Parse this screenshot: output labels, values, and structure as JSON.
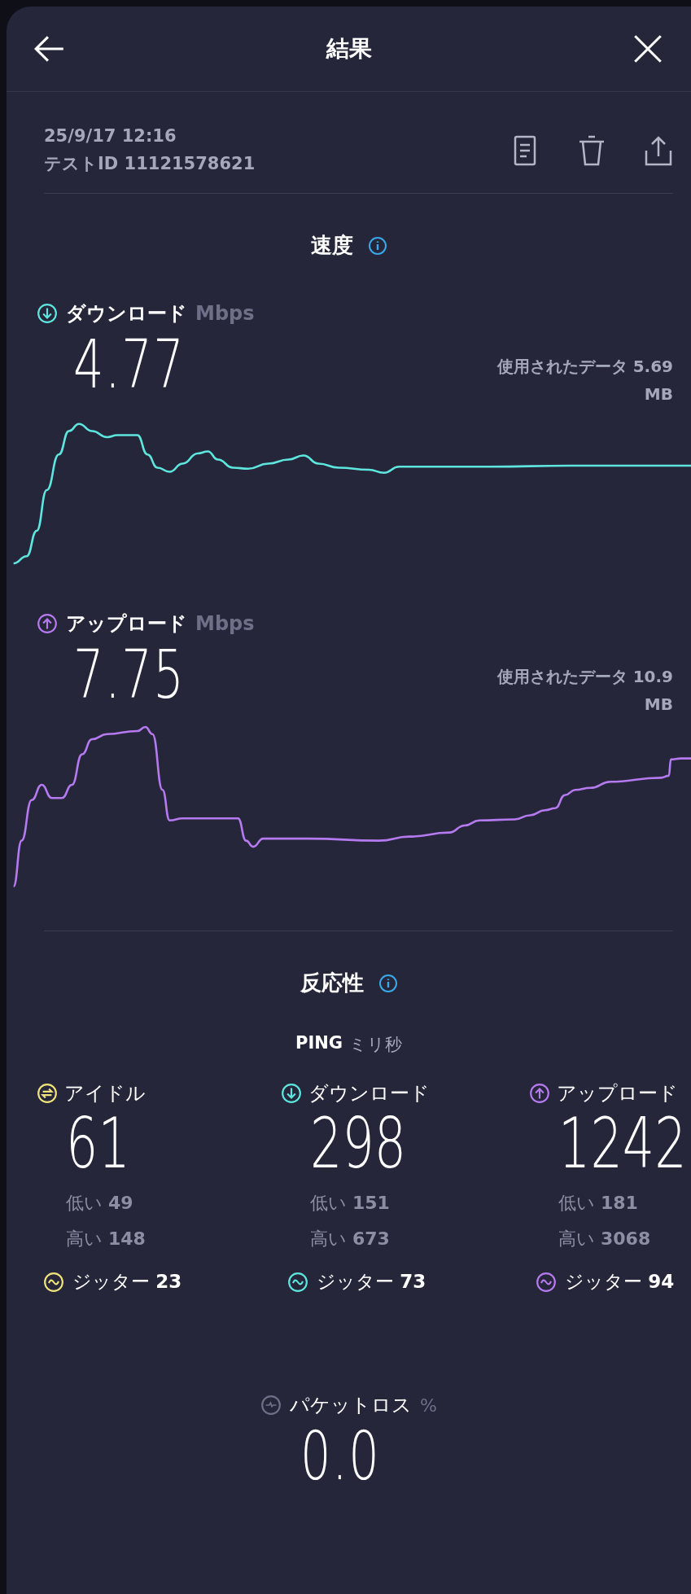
{
  "header": {
    "title": "結果"
  },
  "test": {
    "date": "25/9/17 12:16",
    "id": "テストID 11121578621"
  },
  "speed": {
    "title": "速度",
    "results": [
      {
        "kind": "download",
        "color": "#5ee6de",
        "label": "ダウンロード",
        "unit": "Mbps",
        "value": "4.77",
        "data_used": "使用されたデータ 5.69",
        "data_unit": "MB"
      },
      {
        "kind": "upload",
        "color": "#b57af0",
        "label": "アップロード",
        "unit": "Mbps",
        "value": "7.75",
        "data_used": "使用されたデータ 10.9",
        "data_unit": "MB"
      }
    ]
  },
  "responsiveness": {
    "title": "反応性",
    "ping_label": "PING",
    "ping_unit": "ミリ秒",
    "columns": [
      {
        "kind": "idle",
        "color": "#f0e27a",
        "label": "アイドル",
        "value": "61",
        "low": "低い **49**",
        "high": "高い **148**",
        "jitter": "ジッター **23**"
      },
      {
        "kind": "download",
        "color": "#5ee6de",
        "label": "ダウンロード",
        "value": "298",
        "low": "低い **151**",
        "high": "高い **673**",
        "jitter": "ジッター **73**"
      },
      {
        "kind": "upload",
        "color": "#b57af0",
        "label": "アップロード",
        "value": "1242",
        "low": "低い **181**",
        "high": "高い **3068**",
        "jitter": "ジッター **94**"
      }
    ]
  },
  "packet_loss": {
    "label": "パケットロス",
    "unit": "%",
    "value": "0.0"
  }
}
